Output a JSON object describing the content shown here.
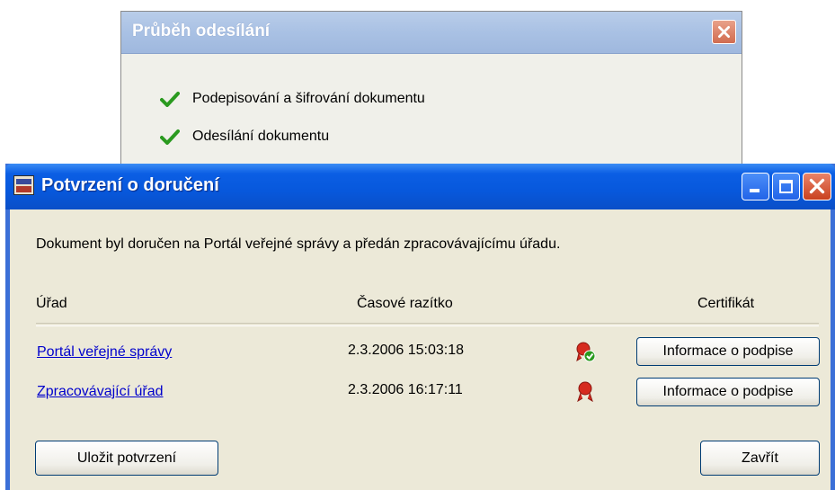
{
  "progress_window": {
    "title": "Průběh odesílání",
    "steps": [
      {
        "label": "Podepisování a šifrování dokumentu",
        "status_icon": "check-icon"
      },
      {
        "label": "Odesílání dokumentu",
        "status_icon": "check-icon"
      }
    ]
  },
  "dialog": {
    "title": "Potvrzení o doručení",
    "message": "Dokument byl doručen na Portál veřejné správy a předán zpracovávajícímu úřadu.",
    "columns": {
      "office": "Úřad",
      "timestamp": "Časové razítko",
      "certificate": "Certifikát"
    },
    "rows": [
      {
        "office": "Portál veřejné správy",
        "timestamp": "2.3.2006 15:03:18",
        "seal_icon": "verified-seal-icon",
        "button": "Informace o podpise"
      },
      {
        "office": "Zpracovávající úřad",
        "timestamp": "2.3.2006 16:17:11",
        "seal_icon": "seal-icon",
        "button": "Informace o podpise"
      }
    ],
    "buttons": {
      "save": "Uložit potvrzení",
      "close": "Zavřít"
    }
  },
  "colors": {
    "titlebar_blue": "#0758dc",
    "dialog_body": "#ece9d8",
    "link": "#0000cc",
    "check_green": "#2a9a1f",
    "seal_red": "#d62b1f"
  }
}
